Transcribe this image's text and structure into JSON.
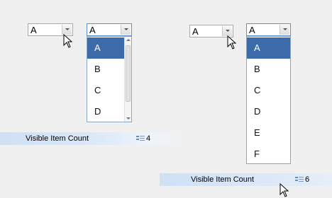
{
  "left_demo": {
    "closed_combo": {
      "value": "A"
    },
    "open_combo": {
      "value": "A"
    },
    "list_items": [
      "A",
      "B",
      "C",
      "D"
    ],
    "selected_item": "A"
  },
  "right_demo": {
    "closed_combo": {
      "value": "A"
    },
    "open_combo": {
      "value": "A"
    },
    "list_items": [
      "A",
      "B",
      "C",
      "D",
      "E",
      "F"
    ],
    "selected_item": "A"
  },
  "property_bar_left": {
    "label": "Visible Item Count",
    "value": "4"
  },
  "property_bar_right": {
    "label": "Visible Item Count",
    "value": "6"
  },
  "icons": {
    "dropdown": "chevron-down-icon",
    "numeric": "numeric-field-icon",
    "cursor": "mouse-pointer-icon"
  },
  "colors": {
    "selection": "#3d6aa8",
    "focus_border": "#5b8fd6",
    "property_bar": "#cfe0f5"
  }
}
